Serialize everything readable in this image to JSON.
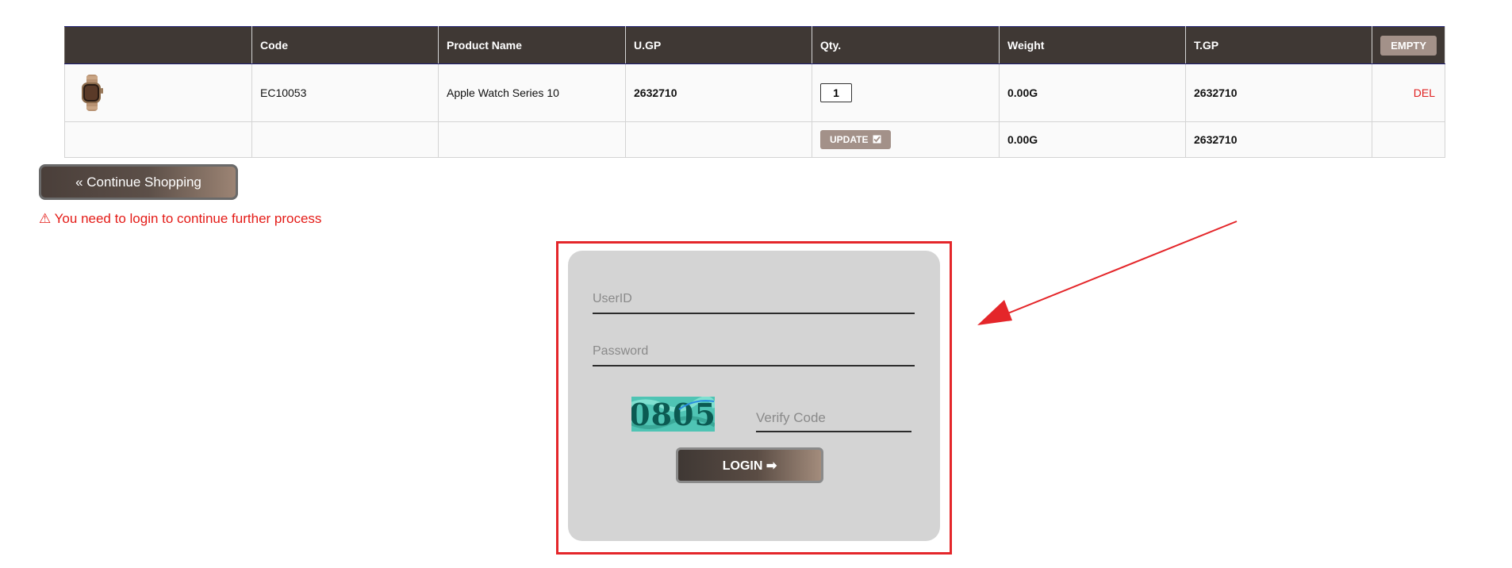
{
  "cart": {
    "headers": [
      "Code",
      "Product Name",
      "U.GP",
      "Qty.",
      "Weight",
      "T.GP"
    ],
    "empty_label": "EMPTY",
    "item": {
      "image": "apple-watch-thumbnail",
      "code": "EC10053",
      "name": "Apple Watch Series 10",
      "unit_gp": "2632710",
      "qty": "1",
      "weight": "0.00G",
      "total_gp": "2632710",
      "delete_label": "DEL"
    },
    "totals": {
      "update_label": "UPDATE",
      "weight": "0.00G",
      "total_gp": "2632710"
    }
  },
  "continue_shopping_label": "« Continue Shopping",
  "login_message": "⚠ You need to login to continue further process",
  "login": {
    "userid_placeholder": "UserID",
    "password_placeholder": "Password",
    "captcha_text": "0805",
    "verify_placeholder": "Verify Code",
    "login_label": "LOGIN ➡"
  },
  "colors": {
    "header_bg": "#3f3834",
    "accent_button": "#a39189",
    "alert_red": "#e41b17",
    "panel_bg": "#d4d4d4",
    "highlight_border": "#e4262a"
  }
}
